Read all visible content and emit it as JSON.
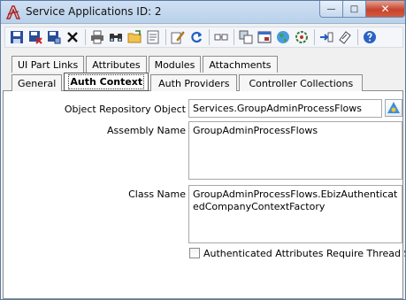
{
  "window": {
    "title": "Service Applications ID: 2",
    "minimize_glyph": "—",
    "maximize_glyph": "□",
    "close_glyph": "✕"
  },
  "toolbar": {
    "icons": [
      "save-icon",
      "save-delete-icon",
      "save-as-icon",
      "delete-icon",
      "print-icon",
      "find-icon",
      "open-folder-icon",
      "form-icon",
      "edit-icon",
      "refresh-icon",
      "link-icon",
      "copy-icon",
      "window-icon",
      "globe-icon",
      "settings-icon",
      "navigate-icon",
      "note-icon",
      "help-icon"
    ]
  },
  "tabs": {
    "row1": [
      "UI Part Links",
      "Attributes",
      "Modules",
      "Attachments"
    ],
    "row2": [
      "General",
      "Auth Context",
      "Auth Providers",
      "Controller Collections"
    ],
    "active": "Auth Context"
  },
  "form": {
    "object_repository_object": {
      "label": "Object Repository Object",
      "value": "Services.GroupAdminProcessFlows"
    },
    "assembly_name": {
      "label": "Assembly Name",
      "value": "GroupAdminProcessFlows"
    },
    "class_name": {
      "label": "Class Name",
      "value": "GroupAdminProcessFlows.EbizAuthenticatedCompanyContextFactory"
    },
    "authenticated_attributes": {
      "label": "Authenticated Attributes Require Thread Sa",
      "checked": false
    }
  }
}
